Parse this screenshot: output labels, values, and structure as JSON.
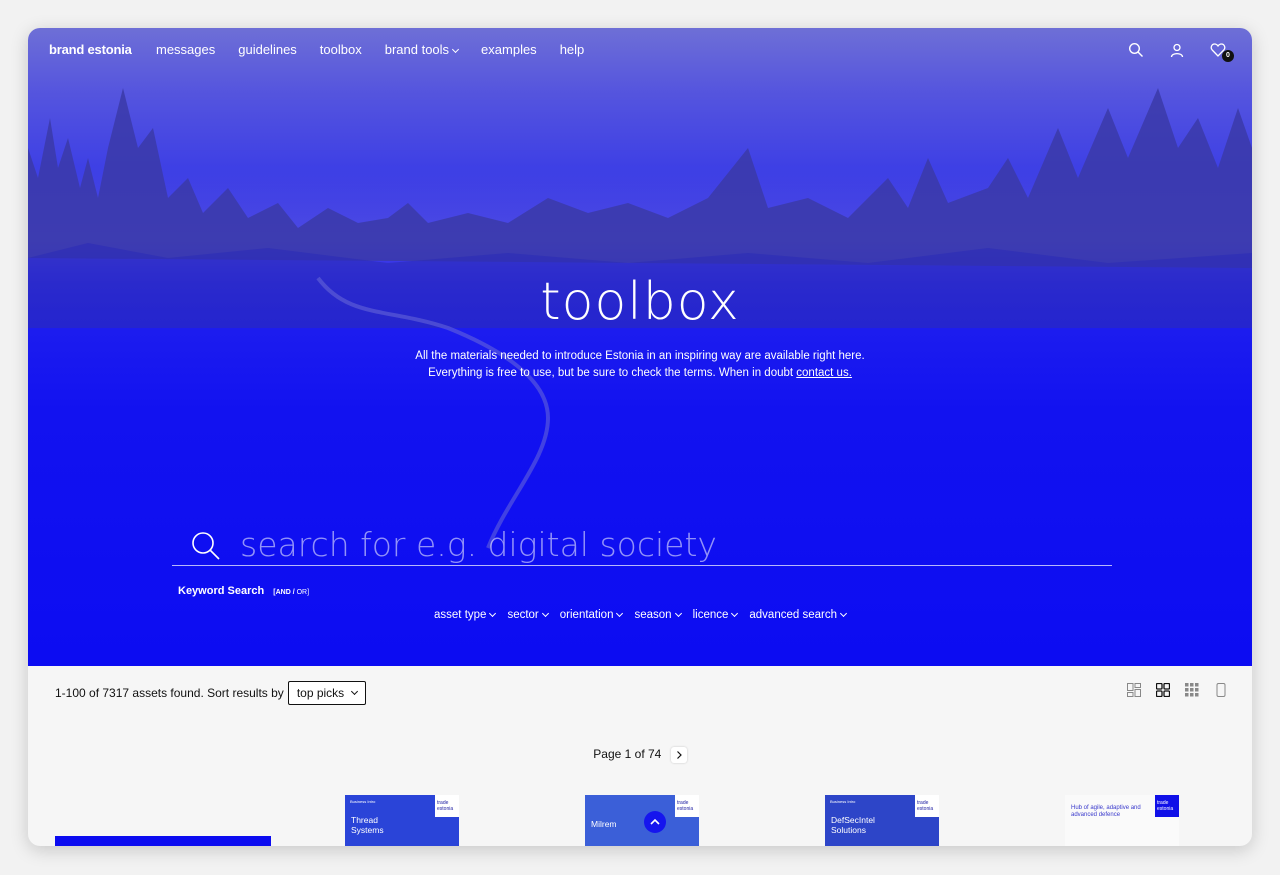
{
  "nav": {
    "brand": "brand estonia",
    "links": [
      "messages",
      "guidelines",
      "toolbox",
      "brand tools",
      "examples",
      "help"
    ],
    "cart_count": "0"
  },
  "hero": {
    "title": "toolbox",
    "intro_line1": "All the materials needed to introduce Estonia in an inspiring way are available right here.",
    "intro_line2": "Everything is free to use, but be sure to check the terms. When in doubt",
    "contact_link": "contact us."
  },
  "search": {
    "placeholder": "search for e.g. digital society",
    "mode_label": "Keyword Search",
    "mode_and": "[AND",
    "mode_sep": " / ",
    "mode_or": "OR]"
  },
  "filters": [
    "asset type",
    "sector",
    "orientation",
    "season",
    "licence",
    "advanced search"
  ],
  "results": {
    "summary": "1-100 of 7317 assets found. Sort results by",
    "sort_value": "top picks"
  },
  "pager": {
    "label": "Page 1 of 74"
  },
  "thumbs": [
    {
      "title": "",
      "small": "",
      "badge": ""
    },
    {
      "title": "Thread\nSystems",
      "small": "Business Intro",
      "badge": "trade\nestonia"
    },
    {
      "title": "Milrem",
      "small": "",
      "badge": "trade\nestonia"
    },
    {
      "title": "DefSecIntel\nSolutions",
      "small": "Business Intro",
      "badge": "trade\nestonia"
    },
    {
      "title": "Hub of agile, adaptive and advanced defence",
      "small": "",
      "badge": "trade\nestonia"
    }
  ],
  "colors": {
    "accent": "#0c0cf2",
    "hero_top": "#6e6fd6"
  }
}
